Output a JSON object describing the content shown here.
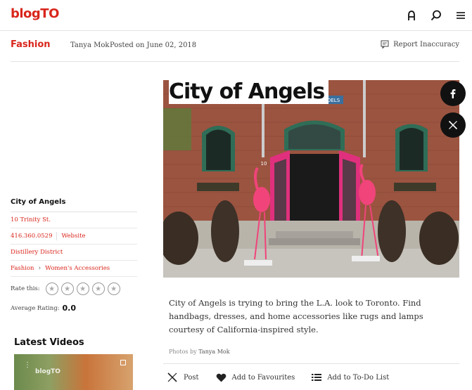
{
  "header": {
    "logo": "blogTO",
    "icons": [
      "user-icon",
      "search-icon",
      "menu-icon"
    ]
  },
  "subbar": {
    "section": "Fashion",
    "author": "Tanya Mok",
    "posted": "Posted on June 02, 2018",
    "report": "Report Inaccuracy"
  },
  "article": {
    "title": "City of Angels",
    "description": "City of Angels is trying to bring the L.A. look to Toronto. Find handbags, dresses, and home accessories like rugs and lamps courtesy of California-inspired style.",
    "credit_prefix": "Photos by",
    "credit_name": "Tanya Mok",
    "photo_sign": "OELS",
    "photo_number": "10"
  },
  "sidebar": {
    "name": "City of Angels",
    "address": "10 Trinity St.",
    "phone": "416.360.0529",
    "website": "Website",
    "neighbourhood": "Distillery District",
    "category": "Fashion",
    "subcategory": "Women's Accessories",
    "rate_label": "Rate this:",
    "avg_label": "Average Rating:",
    "avg_value": "0.0",
    "star_count": 5
  },
  "videos": {
    "title": "Latest Videos",
    "thumb_logo": "blogTO"
  },
  "actions": {
    "post": "Post",
    "favourites": "Add to Favourites",
    "todo": "Add to To-Do List"
  },
  "colors": {
    "brand_red": "#d9261c",
    "text": "#222222",
    "share_bg": "#111111"
  }
}
